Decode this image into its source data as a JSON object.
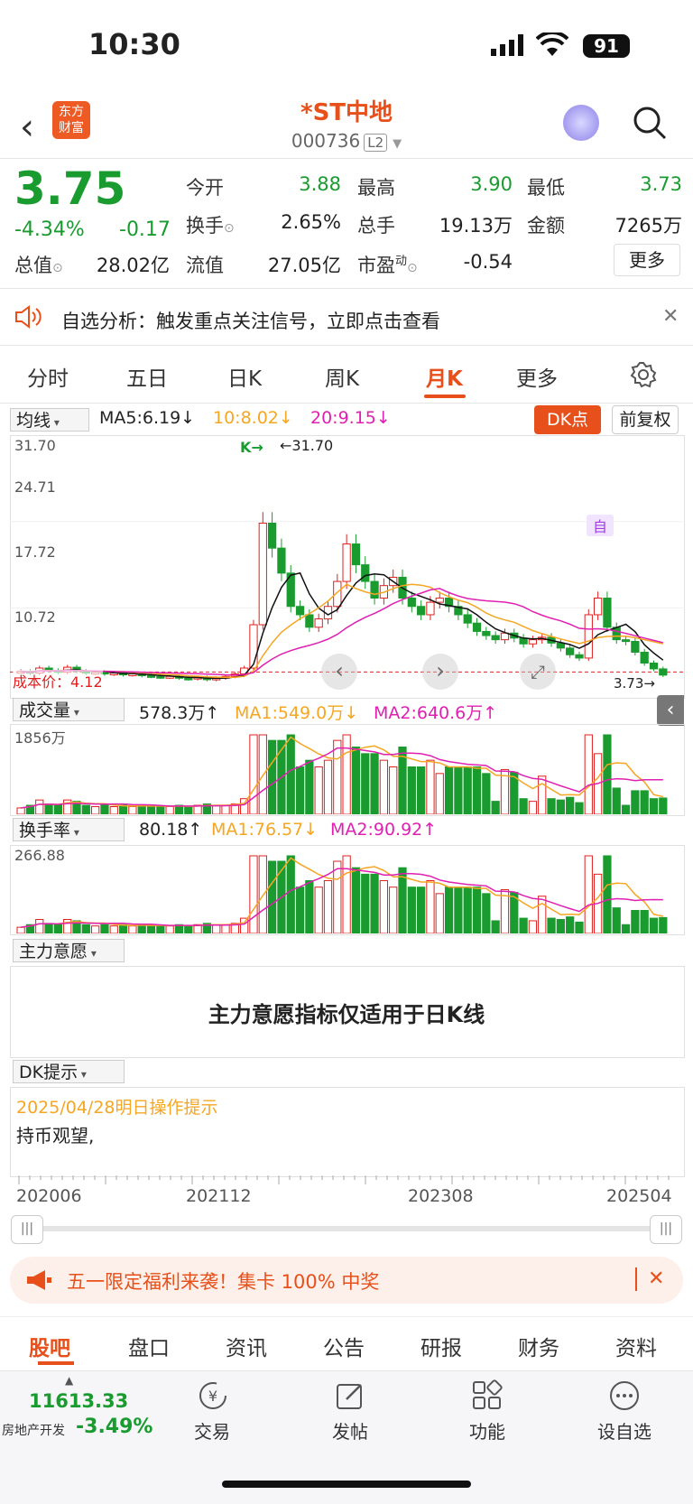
{
  "status": {
    "time": "10:30",
    "battery": "91"
  },
  "header": {
    "title": "*ST中地",
    "code": "000736",
    "level": "L2",
    "logo_line1": "东方",
    "logo_line2": "财富"
  },
  "quote": {
    "price": "3.75",
    "change_pct": "-4.34%",
    "change": "-0.17",
    "open_label": "今开",
    "open": "3.88",
    "high_label": "最高",
    "high": "3.90",
    "low_label": "最低",
    "low": "3.73",
    "turnover_label": "换手",
    "turnover": "2.65%",
    "volume_label": "总手",
    "volume": "19.13万",
    "amount_label": "金额",
    "amount": "7265万",
    "mktcap_label": "总值",
    "mktcap": "28.02亿",
    "float_label": "流值",
    "float": "27.05亿",
    "pe_label": "市盈",
    "pe_sup": "动",
    "pe": "-0.54",
    "more": "更多"
  },
  "notice": {
    "text": "自选分析：触发重点关注信号，立即点击查看"
  },
  "tabs": [
    "分时",
    "五日",
    "日K",
    "周K",
    "月K",
    "更多"
  ],
  "active_tab": 4,
  "kline": {
    "indicator": "均线",
    "ma5": "MA5:6.19↓",
    "ma10": "10:8.02↓",
    "ma20": "20:9.15↓",
    "dk_btn": "DK点",
    "adjust": "前复权",
    "y_labels": [
      "31.70",
      "24.71",
      "17.72",
      "10.72"
    ],
    "max_label": "←31.70",
    "min_label": "3.73→",
    "cost_label": "成本价：4.12",
    "k_marker": "K→",
    "self_marker": "自"
  },
  "volume": {
    "indicator": "成交量",
    "value": "578.3万↑",
    "ma1": "MA1:549.0万↓",
    "ma2": "MA2:640.6万↑",
    "y_label": "1856万"
  },
  "turnover_ind": {
    "indicator": "换手率",
    "value": "80.18↑",
    "ma1": "MA1:76.57↓",
    "ma2": "MA2:90.92↑",
    "y_label": "266.88"
  },
  "main_intent": {
    "indicator": "主力意愿",
    "message": "主力意愿指标仅适用于日K线"
  },
  "dk": {
    "indicator": "DK提示",
    "date_line": "2025/04/28明日操作提示",
    "advice": "持币观望,"
  },
  "x_axis": [
    "202006",
    "202112",
    "202308",
    "202504"
  ],
  "promo": {
    "text": "五一限定福利来袭！集卡 100% 中奖"
  },
  "bottom_tabs": [
    "股吧",
    "盘口",
    "资讯",
    "公告",
    "研报",
    "财务",
    "资料"
  ],
  "footer": {
    "index_value": "11613.33",
    "index_name": "房地产开发",
    "index_change": "-3.49%",
    "trade": "交易",
    "post": "发帖",
    "func": "功能",
    "watch": "设自选"
  },
  "colors": {
    "up": "#e02020",
    "down": "#1a9b2f",
    "accent": "#e8501b",
    "ma10": "#f5a623",
    "ma20": "#e020b0"
  },
  "chart_data": {
    "type": "candlestick",
    "prices": [
      4.2,
      4.0,
      4.6,
      4.3,
      4.1,
      4.7,
      4.2,
      4.0,
      4.1,
      3.9,
      4.0,
      3.8,
      3.9,
      3.7,
      3.6,
      3.5,
      3.6,
      3.4,
      3.3,
      3.5,
      3.2,
      3.4,
      3.6,
      3.9,
      4.6,
      9.8,
      22.0,
      19.0,
      16.0,
      12.0,
      11.0,
      9.5,
      10.5,
      12.0,
      15.0,
      19.5,
      17.0,
      15.0,
      13.0,
      14.5,
      15.5,
      13.0,
      12.0,
      11.0,
      12.5,
      13.0,
      12.0,
      11.0,
      10.0,
      9.0,
      8.5,
      8.0,
      8.8,
      8.2,
      7.5,
      8.0,
      8.3,
      7.6,
      7.0,
      6.2,
      5.8,
      11.0,
      13.0,
      9.5,
      8.0,
      7.8,
      6.5,
      5.2,
      4.5,
      3.75
    ]
  }
}
